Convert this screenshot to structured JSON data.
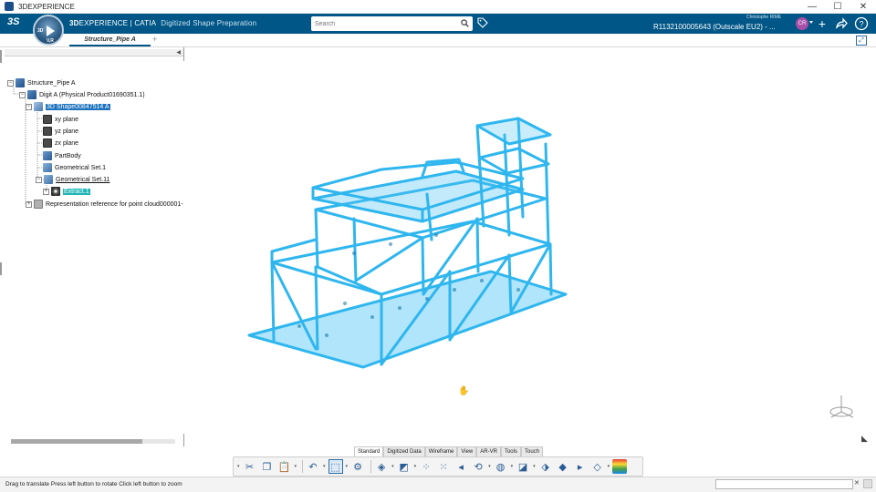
{
  "window": {
    "title": "3DEXPERIENCE",
    "controls": [
      "—",
      "☐",
      "✕"
    ]
  },
  "topbar": {
    "brand_prefix": "3D",
    "brand_main": "EXPERIENCE | CATIA",
    "app_name": "Digitized Shape Preparation",
    "search_placeholder": "Search",
    "user_name": "Christophe RIME",
    "tenant": "R1132100005643  (Outscale EU2) - ...",
    "avatar_initials": "CR",
    "compass_labels": [
      "3D",
      "V,R"
    ]
  },
  "tabs": {
    "active_label": "Structure_Pipe A",
    "add_label": "+"
  },
  "tree": {
    "nodes": [
      {
        "label": "Structure_Pipe A",
        "icon": "product-icon"
      },
      {
        "label": "Digit A (Physical Product01690351.1)",
        "icon": "product-icon"
      },
      {
        "label": "3D Shape00847514 A",
        "icon": "shape-icon"
      },
      {
        "label": "xy plane",
        "icon": "plane-icon"
      },
      {
        "label": "yz plane",
        "icon": "plane-icon"
      },
      {
        "label": "zx plane",
        "icon": "plane-icon"
      },
      {
        "label": "PartBody",
        "icon": "body-icon"
      },
      {
        "label": "Geometrical Set.1",
        "icon": "geometrical-set-icon"
      },
      {
        "label": "Geometrical Set.11",
        "icon": "geometrical-set-icon"
      },
      {
        "label": "Extract.1",
        "icon": "cloud-icon"
      },
      {
        "label": "Representation reference for point cloud000001-",
        "icon": "representation-icon"
      }
    ]
  },
  "action_bar": {
    "tabs": [
      "Standard",
      "Digitized Data",
      "Wireframe",
      "View",
      "AR-VR",
      "Tools",
      "Touch"
    ],
    "active_tab": "Standard"
  },
  "status": {
    "message": "Drag to translate  Press left button to rotate  Click left button to zoom"
  },
  "colors": {
    "topbar": "#005686",
    "model": "#2fb6ef",
    "selection": "#1e73be",
    "highlight": "#1fb5b5"
  }
}
